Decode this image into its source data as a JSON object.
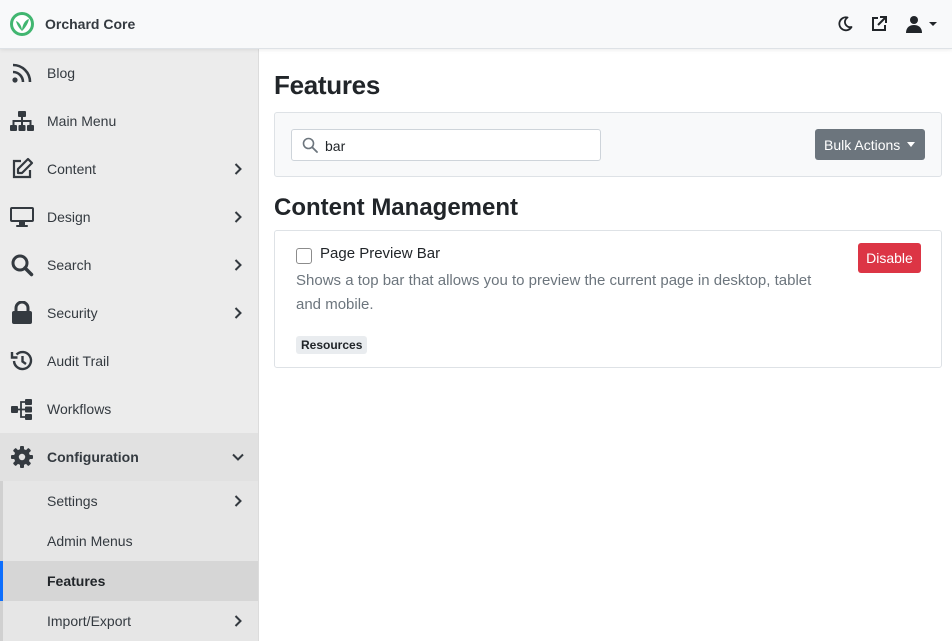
{
  "header": {
    "brand": "Orchard Core",
    "brand_color": "#41b670",
    "actions": [
      {
        "icon": "moon-icon"
      },
      {
        "icon": "external-link-icon"
      },
      {
        "icon": "user-icon"
      }
    ]
  },
  "sidebar": {
    "items": [
      {
        "label": "Blog",
        "icon": "rss-icon",
        "has_children": false
      },
      {
        "label": "Main Menu",
        "icon": "sitemap-icon",
        "has_children": false
      },
      {
        "label": "Content",
        "icon": "edit-icon",
        "has_children": true
      },
      {
        "label": "Design",
        "icon": "monitor-icon",
        "has_children": true
      },
      {
        "label": "Search",
        "icon": "search-icon",
        "has_children": true
      },
      {
        "label": "Security",
        "icon": "lock-icon",
        "has_children": true
      },
      {
        "label": "Audit Trail",
        "icon": "history-icon",
        "has_children": false
      },
      {
        "label": "Workflows",
        "icon": "workflow-icon",
        "has_children": false
      },
      {
        "label": "Configuration",
        "icon": "gear-icon",
        "has_children": true,
        "expanded": true
      }
    ],
    "configuration_children": [
      {
        "label": "Settings",
        "has_children": true
      },
      {
        "label": "Admin Menus",
        "has_children": false
      },
      {
        "label": "Features",
        "has_children": false,
        "active": true
      },
      {
        "label": "Import/Export",
        "has_children": true
      }
    ]
  },
  "main": {
    "title": "Features",
    "search": {
      "value": "bar"
    },
    "bulk_actions_label": "Bulk Actions",
    "section_title": "Content Management",
    "feature": {
      "name": "Page Preview Bar",
      "description": "Shows a top bar that allows you to preview the current page in desktop, tablet and mobile.",
      "tag": "Resources",
      "action_label": "Disable",
      "action_color": "#dc3545",
      "checked": false
    }
  }
}
